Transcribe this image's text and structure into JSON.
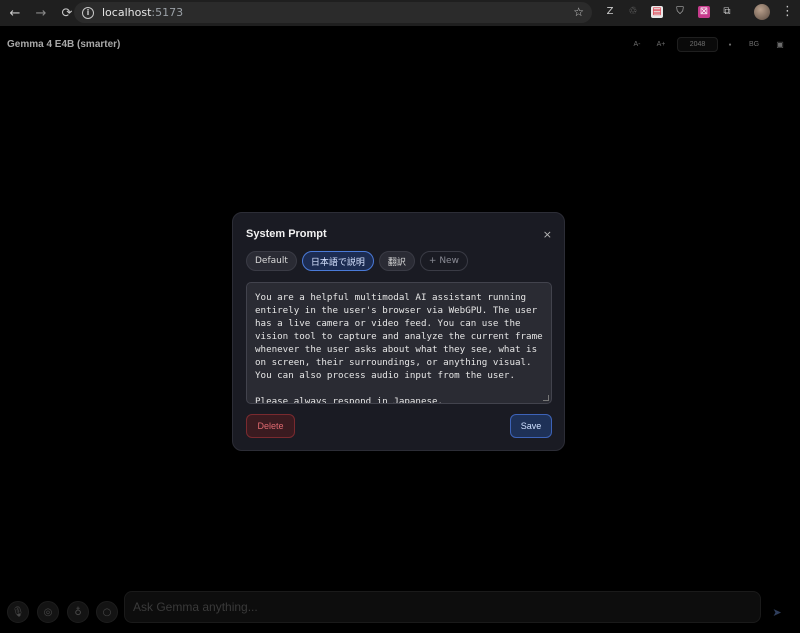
{
  "browser": {
    "url_host": "localhost",
    "url_port": ":5173",
    "back_icon": "←",
    "forward_icon": "→",
    "reload_icon": "⟳",
    "info_icon": "i",
    "star_icon": "☆",
    "menu_icon": "⋮",
    "extensions": [
      "Z",
      "♲",
      "▤",
      "⛉",
      "⊠",
      "⧉"
    ]
  },
  "app": {
    "title": "Gemma 4 E4B (smarter)",
    "controls": {
      "font_decrease": "A-",
      "font_increase": "A+",
      "max_tokens": "2048",
      "dot": "●",
      "bg_label": "BG",
      "view_icon": "▣"
    }
  },
  "modal": {
    "title": "System Prompt",
    "close_label": "×",
    "chips": [
      {
        "label": "Default",
        "active": false
      },
      {
        "label": "日本語で説明",
        "active": true
      },
      {
        "label": "翻訳",
        "active": false
      },
      {
        "label": "+ New",
        "active": false
      }
    ],
    "prompt_text": "You are a helpful multimodal AI assistant running entirely in the user's browser via WebGPU. The user has a live camera or video feed. You can use the vision tool to capture and analyze the current frame whenever the user asks about what they see, what is on screen, their surroundings, or anything visual. You can also process audio input from the user.\n\nPlease always respond in Japanese.",
    "delete_label": "Delete",
    "save_label": "Save"
  },
  "composer": {
    "placeholder": "Ask Gemma anything...",
    "mic_icon": "🎙",
    "camera_icon": "◎",
    "bulb_icon": "♁",
    "search_icon": "○",
    "send_icon": "➤"
  },
  "colors": {
    "accent": "#4a7ad8",
    "danger": "#e06a70",
    "modal_bg": "#1a1b23"
  }
}
